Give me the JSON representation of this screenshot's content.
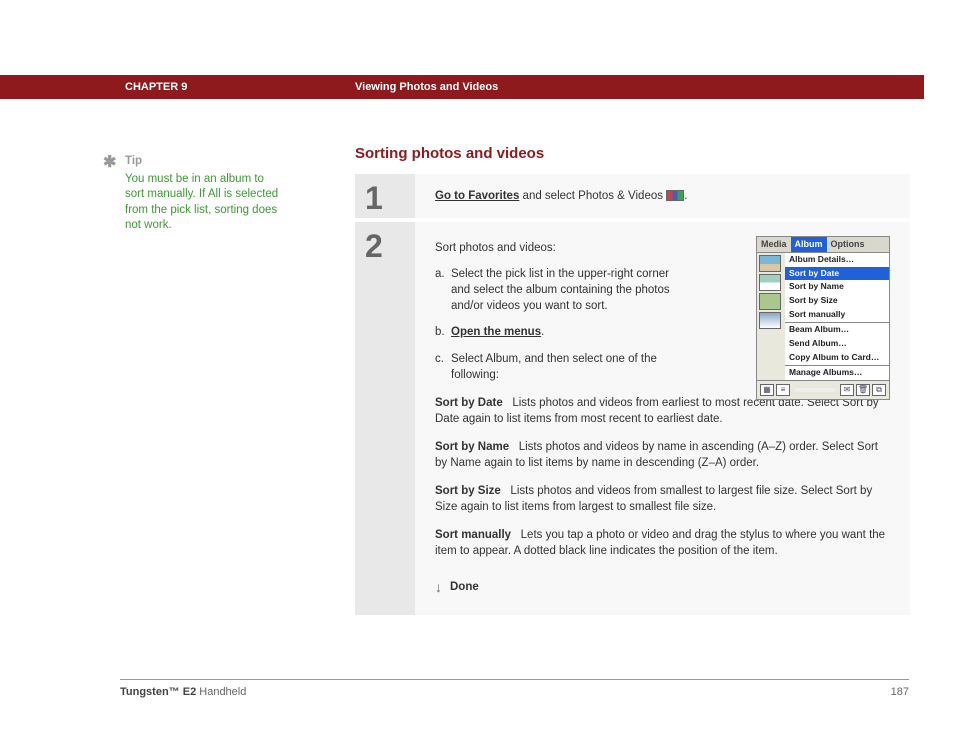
{
  "header": {
    "chapter": "CHAPTER 9",
    "title": "Viewing Photos and Videos"
  },
  "tip": {
    "label": "Tip",
    "body": "You must be in an album to sort manually. If All is selected from the pick list, sorting does not work."
  },
  "section": {
    "title": "Sorting photos and videos"
  },
  "step1": {
    "num": "1",
    "link": "Go to Favorites",
    "rest": " and select Photos & Videos "
  },
  "step2": {
    "num": "2",
    "intro": "Sort photos and videos:",
    "a": "Select the pick list in the upper-right corner and select the album containing the photos and/or videos you want to sort.",
    "b_link": "Open the menus",
    "b_suffix": ".",
    "c": "Select Album, and then select one of the following:",
    "sort_by_date_key": "Sort by Date",
    "sort_by_date_desc": "Lists photos and videos from earliest to most recent date. Select Sort by Date again to list items from most recent to earliest date.",
    "sort_by_name_key": "Sort by Name",
    "sort_by_name_desc": "Lists photos and videos by name in ascending (A–Z) order. Select Sort by Name again to list items by name in descending (Z–A) order.",
    "sort_by_size_key": "Sort by Size",
    "sort_by_size_desc": "Lists photos and videos from smallest to largest file size. Select Sort by Size again to list items from largest to smallest file size.",
    "sort_manually_key": "Sort manually",
    "sort_manually_desc": "Lets you tap a photo or video and drag the stylus to where you want the item to appear. A dotted black line indicates the position of the item.",
    "done": "Done"
  },
  "screenshot": {
    "tabs": {
      "media": "Media",
      "album": "Album",
      "options": "Options"
    },
    "menu": {
      "details": "Album Details…",
      "sort_date": "Sort by Date",
      "sort_name": "Sort by Name",
      "sort_size": "Sort by Size",
      "sort_manual": "Sort manually",
      "beam": "Beam Album…",
      "send": "Send Album…",
      "copy": "Copy Album to Card…",
      "manage": "Manage Albums…"
    }
  },
  "footer": {
    "product_bold": "Tungsten™ E2",
    "product_rest": " Handheld",
    "page": "187"
  }
}
